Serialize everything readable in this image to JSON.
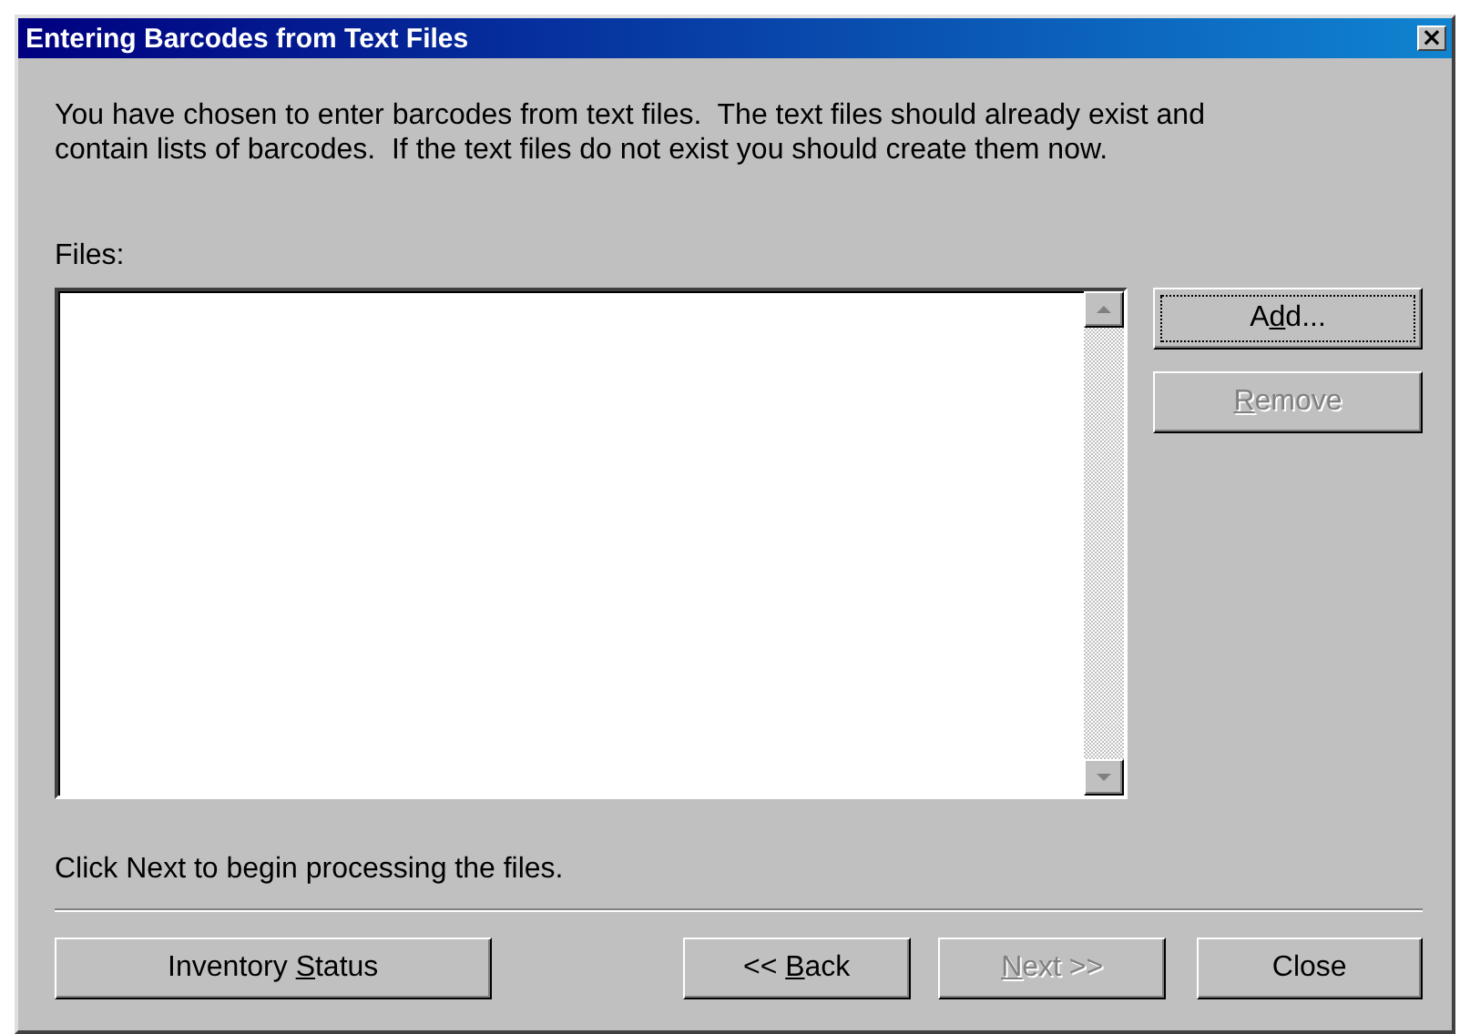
{
  "window": {
    "title": "Entering Barcodes from Text Files",
    "close": "×"
  },
  "intro": "You have chosen to enter barcodes from text files.  The text files should already exist and contain lists of barcodes.  If the text files do not exist you should create them now.",
  "files": {
    "label": "Files:"
  },
  "side_buttons": [
    {
      "label": {
        "before": "A",
        "key": "d",
        "after": "d..."
      },
      "disabled": false,
      "focused": true
    },
    {
      "label": {
        "key": "R",
        "after": "emove"
      },
      "disabled": true,
      "focused": false
    }
  ],
  "hint": "Click Next to begin processing the files.",
  "bottom_buttons": [
    {
      "label": {
        "before": "Inventory ",
        "key": "S",
        "after": "tatus"
      },
      "disabled": false
    },
    {
      "label": {
        "before": "<< ",
        "key": "B",
        "after": "ack"
      },
      "disabled": false
    },
    {
      "label": {
        "key": "N",
        "after": "ext >>"
      },
      "disabled": true
    },
    {
      "label": {
        "before": "Close"
      },
      "disabled": false
    }
  ]
}
